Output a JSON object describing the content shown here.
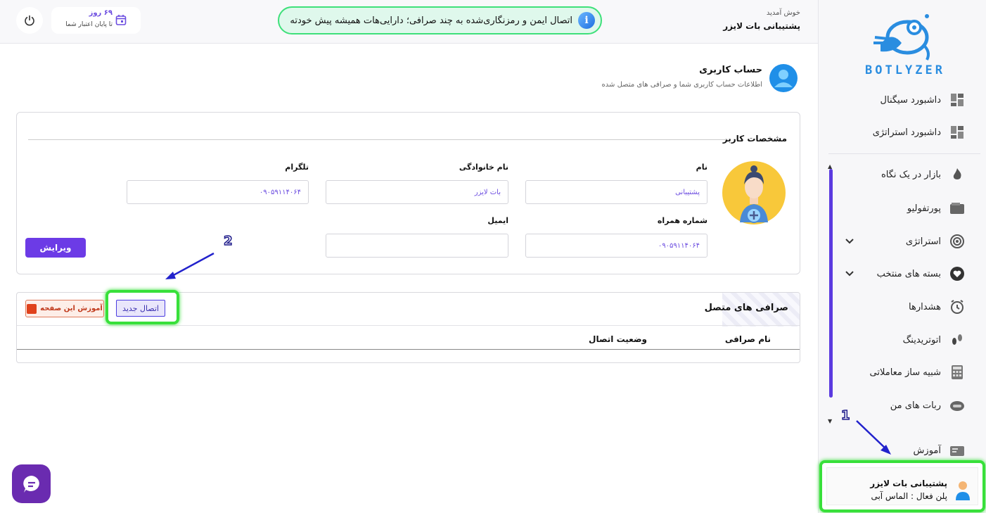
{
  "brand": {
    "name": "BOTLYZER"
  },
  "sidebar": {
    "items": [
      {
        "label": "داشبورد سیگنال",
        "icon": "dashboard-icon"
      },
      {
        "label": "داشبورد استراتژی",
        "icon": "dashboard-icon"
      },
      {
        "label": "بازار در یک نگاه",
        "icon": "fire-icon"
      },
      {
        "label": "پورتفولیو",
        "icon": "wallet-icon"
      },
      {
        "label": "استراتژی",
        "icon": "target-icon"
      },
      {
        "label": "بسته های منتخب",
        "icon": "heart-icon"
      },
      {
        "label": "هشدارها",
        "icon": "alarm-icon"
      },
      {
        "label": "اتوتریدینگ",
        "icon": "footsteps-icon"
      },
      {
        "label": "شبیه ساز معاملاتی",
        "icon": "calculator-icon"
      },
      {
        "label": "ربات های من",
        "icon": "robot-icon"
      },
      {
        "label": "آموزش",
        "icon": "education-icon"
      }
    ],
    "user": {
      "name": "پشتیبانی بات لایزر",
      "plan": "پلن فعال : الماس آبی"
    }
  },
  "header": {
    "welcome": "خوش آمدید",
    "user_name": "پشتیبانی بات لایزر",
    "banner": "اتصال ایمن و رمزنگاری‌شده به چند صرافی؛ دارایی‌هات همیشه پیش خودته",
    "credit_days": "۶۹ روز",
    "credit_sub": "تا پایان اعتبار شما"
  },
  "page": {
    "title": "حساب کاربری",
    "subtitle": "اطلاعات حساب کاربری شما و صرافی های متصل شده"
  },
  "profile": {
    "section_title": "مشخصات کاربر",
    "fields": {
      "first_name_label": "نام",
      "first_name": "پشتیبانی",
      "last_name_label": "نام خانوادگی",
      "last_name": "بات لایزر",
      "telegram_label": "تلگرام",
      "telegram": "۰۹۰۵۹۱۱۴۰۶۴",
      "phone_label": "شماره همراه",
      "phone": "۰۹۰۵۹۱۱۴۰۶۴",
      "email_label": "ایمیل",
      "email": ""
    },
    "edit_label": "ویرایش"
  },
  "exchanges": {
    "title": "صرافی های متصل",
    "new_connection": "اتصال جدید",
    "tutorial": "آموزش این صفحه",
    "columns": [
      "نام صرافی",
      "وضعیت اتصال"
    ]
  },
  "annotations": {
    "one": "1",
    "two": "2"
  },
  "colors": {
    "accent": "#6c3be6",
    "highlight": "#38e03a",
    "logo": "#2a8de0"
  }
}
